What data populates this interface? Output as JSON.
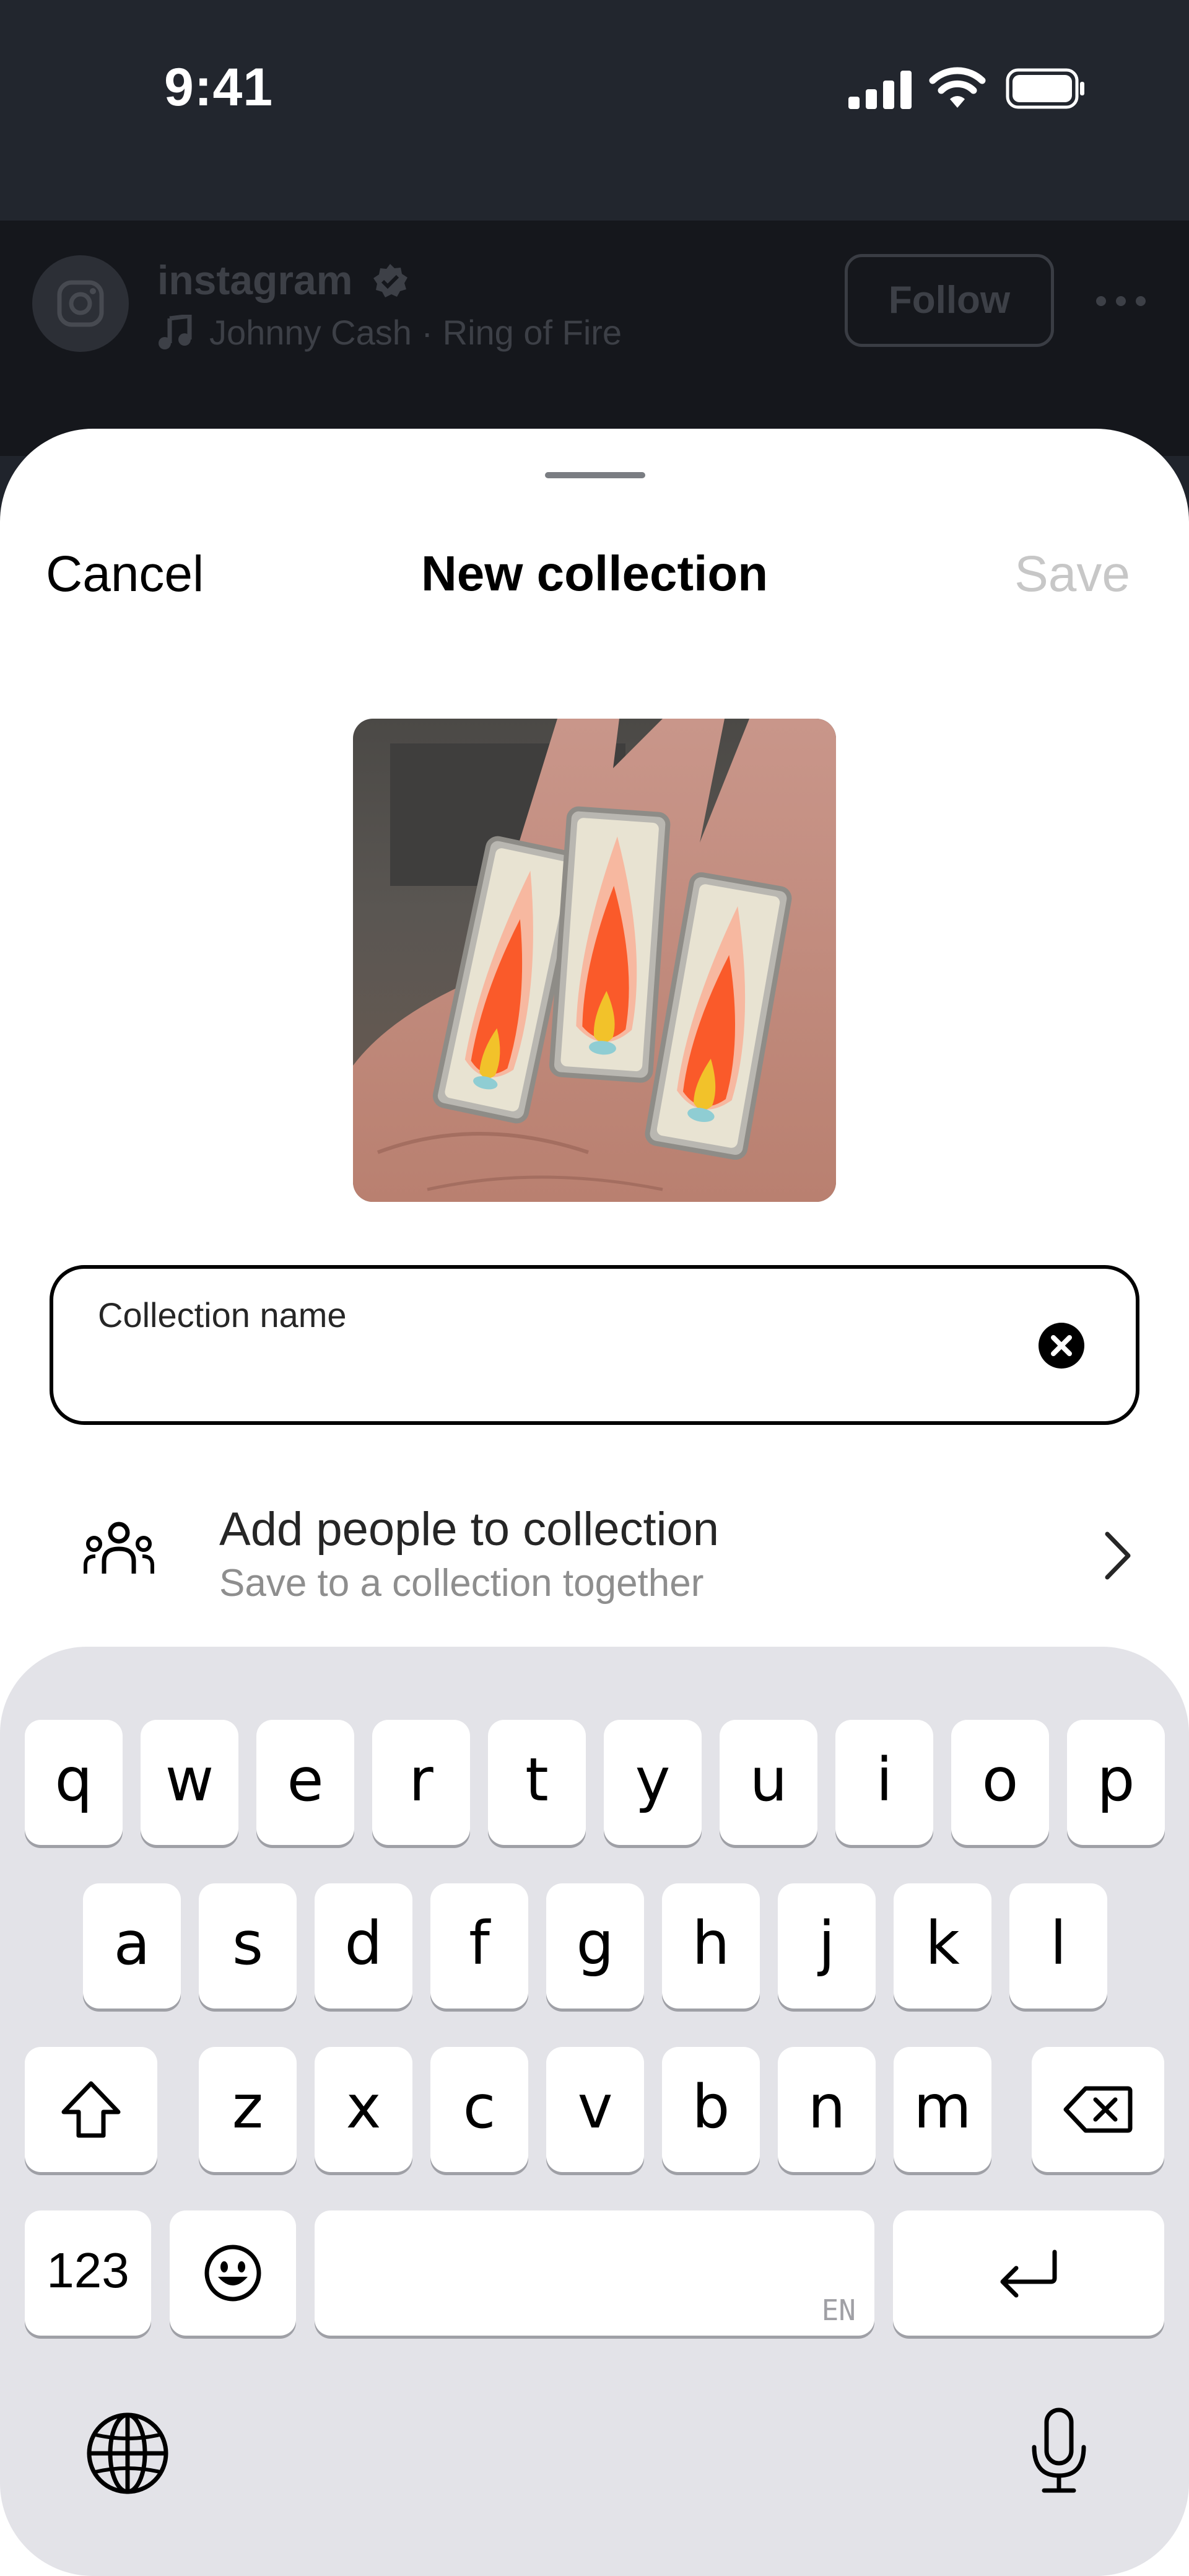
{
  "status_bar": {
    "time": "9:41"
  },
  "post": {
    "account": "instagram",
    "music": "Johnny Cash · Ring of Fire",
    "follow_label": "Follow"
  },
  "sheet": {
    "cancel_label": "Cancel",
    "title": "New collection",
    "save_label": "Save",
    "name_field_label": "Collection name",
    "name_field_value": "",
    "add_people_title": "Add people to collection",
    "add_people_subtitle": "Save to a collection together"
  },
  "keyboard": {
    "row1": [
      "q",
      "w",
      "e",
      "r",
      "t",
      "y",
      "u",
      "i",
      "o",
      "p"
    ],
    "row2": [
      "a",
      "s",
      "d",
      "f",
      "g",
      "h",
      "j",
      "k",
      "l"
    ],
    "row3": [
      "z",
      "x",
      "c",
      "v",
      "b",
      "n",
      "m"
    ],
    "numbers_label": "123",
    "language": "EN"
  },
  "colors": {
    "disabled_save": "#c7c7c7",
    "keyboard_bg": "#e3e3e8",
    "dim_header": "#15171c"
  },
  "icons": [
    "signal-icon",
    "wifi-icon",
    "battery-icon",
    "instagram-logo-icon",
    "verified-icon",
    "music-note-icon",
    "more-icon",
    "clear-icon",
    "people-icon",
    "chevron-right-icon",
    "shift-icon",
    "backspace-icon",
    "emoji-icon",
    "return-icon",
    "globe-icon",
    "microphone-icon"
  ]
}
